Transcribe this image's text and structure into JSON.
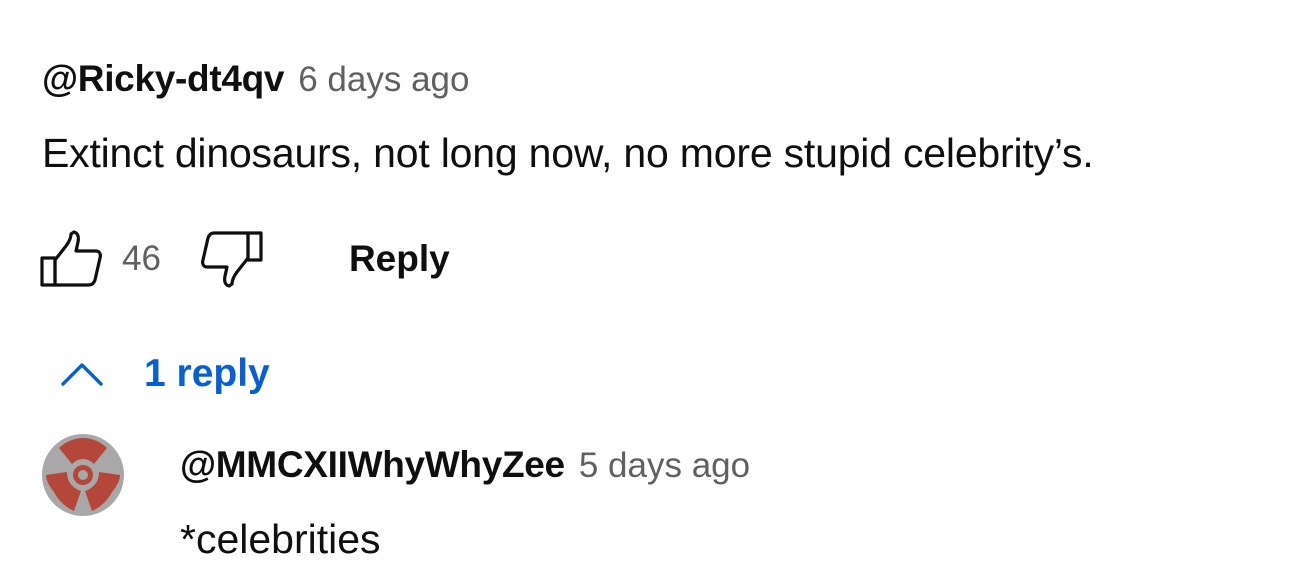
{
  "comment": {
    "author": "@Ricky-dt4qv",
    "time": "6 days ago",
    "text": "Extinct dinosaurs, not long now, no more stupid celebrity’s.",
    "like_count": "46",
    "reply_label": "Reply",
    "like_icon": "thumbs-up-icon",
    "dislike_icon": "thumbs-down-icon"
  },
  "replies_toggle": {
    "label": "1 reply",
    "icon": "chevron-up-icon",
    "color": "#065fd4"
  },
  "reply": {
    "author": "@MMCXIIWhyWhyZee",
    "time": "5 days ago",
    "text": "*celebrities",
    "avatar_icon": "record-adapter-avatar",
    "avatar_colors": [
      "#a8a8a8",
      "#b5463a"
    ]
  }
}
